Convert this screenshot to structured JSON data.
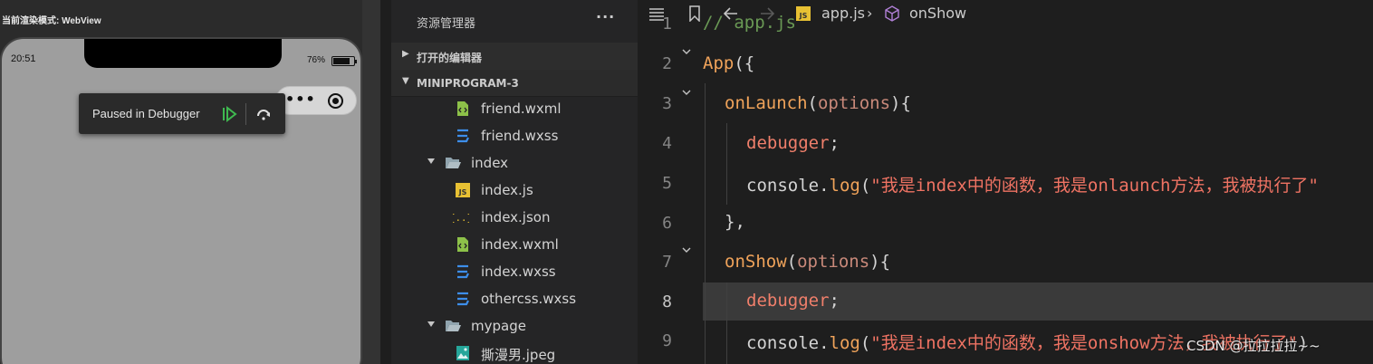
{
  "simulator": {
    "mode_label": "当前渲染模式: WebView",
    "time": "20:51",
    "battery": "76%",
    "paused_label": "Paused in Debugger"
  },
  "explorer": {
    "title": "资源管理器",
    "more": "···",
    "open_editors": "打开的编辑器",
    "project": "MINIPROGRAM-3",
    "items": [
      {
        "label": "friend.wxml",
        "icon": "wxml-file-icon"
      },
      {
        "label": "friend.wxss",
        "icon": "wxss-file-icon"
      },
      {
        "label": "index",
        "icon": "folder-open-icon"
      },
      {
        "label": "index.js",
        "icon": "js-file-icon"
      },
      {
        "label": "index.json",
        "icon": "json-file-icon"
      },
      {
        "label": "index.wxml",
        "icon": "wxml-file-icon"
      },
      {
        "label": "index.wxss",
        "icon": "wxss-file-icon"
      },
      {
        "label": "othercss.wxss",
        "icon": "wxss-file-icon"
      },
      {
        "label": "mypage",
        "icon": "folder-open-icon"
      },
      {
        "label": "撕漫男.jpeg",
        "icon": "image-file-icon"
      }
    ]
  },
  "editor": {
    "breadcrumb_file": "app.js",
    "breadcrumb_symbol": "onShow",
    "current_line": "8",
    "lines": [
      {
        "num": "1",
        "comment": "// app.js"
      },
      {
        "num": "2",
        "fn": "App",
        "rest": "({"
      },
      {
        "num": "3",
        "fn": "onLaunch",
        "open": "(",
        "param": "options",
        "close": "){"
      },
      {
        "num": "4",
        "dbg": "debugger",
        "semi": ";"
      },
      {
        "num": "5",
        "obj": "console.",
        "log": "log",
        "paren": "(",
        "str": "\"我是index中的函数，我是onlaunch方法，我被执行了\""
      },
      {
        "num": "6",
        "text": "},"
      },
      {
        "num": "7",
        "fn": "onShow",
        "open": "(",
        "param": "options",
        "close": "){"
      },
      {
        "num": "8",
        "dbg": "debugger",
        "semi": ";"
      },
      {
        "num": "9",
        "obj": "console.",
        "log": "log",
        "paren": "(",
        "str": "\"我是index中的函数，我是onshow方法，我被执行了\"",
        "end": ")"
      }
    ]
  },
  "watermark": "CSDN @拉拉拉拉~~",
  "colors": {
    "accent_green": "#3fb950",
    "js_yellow": "#e8c133",
    "wxss_blue": "#3d8eea",
    "wxml_green": "#8dc149"
  }
}
